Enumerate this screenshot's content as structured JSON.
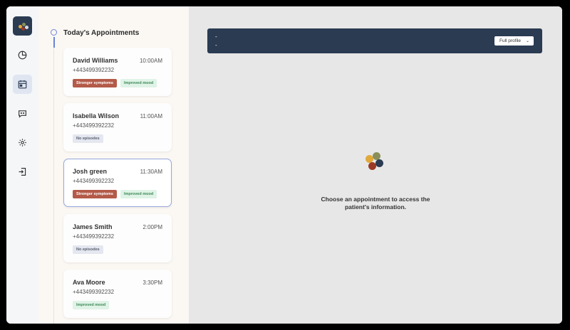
{
  "nav": {
    "items": [
      {
        "icon": "logo-icon"
      },
      {
        "icon": "pie-chart-icon"
      },
      {
        "icon": "calendar-icon",
        "active": true
      },
      {
        "icon": "chat-icon"
      },
      {
        "icon": "gear-icon"
      },
      {
        "icon": "logout-icon"
      }
    ]
  },
  "appointments": {
    "title": "Today's Appointments",
    "items": [
      {
        "name": "David Williams",
        "time": "10:00AM",
        "phone": "+443499392232",
        "tags": [
          {
            "label": "Stronger symptoms",
            "kind": "stronger"
          },
          {
            "label": "Improved mood",
            "kind": "improved"
          }
        ]
      },
      {
        "name": "Isabella Wilson",
        "time": "11:00AM",
        "phone": "+443499392232",
        "tags": [
          {
            "label": "No episodes",
            "kind": "none"
          }
        ]
      },
      {
        "name": "Josh green",
        "time": "11:30AM",
        "phone": "+443499392232",
        "selected": true,
        "tags": [
          {
            "label": "Stronger symptoms",
            "kind": "stronger"
          },
          {
            "label": "Improved mood",
            "kind": "improved"
          }
        ]
      },
      {
        "name": "James Smith",
        "time": "2:00PM",
        "phone": "+443499392232",
        "tags": [
          {
            "label": "No episodes",
            "kind": "none"
          }
        ]
      },
      {
        "name": "Ava Moore",
        "time": "3:30PM",
        "phone": "+443499392232",
        "tags": [
          {
            "label": "Improved mood",
            "kind": "improved"
          }
        ]
      }
    ]
  },
  "header": {
    "line1": "-",
    "line2": "-",
    "profile_button": "Full profile"
  },
  "empty_state": {
    "message": "Choose an appointment to access the patient's information."
  },
  "colors": {
    "navy": "#2a3b52",
    "accent": "#6b84d6",
    "stronger": "#b45a49",
    "improved_bg": "#dff3e6",
    "logo_yellow": "#e2a93a",
    "logo_olive": "#8a8f5a",
    "logo_rust": "#9a3a26",
    "logo_navy": "#2a3b52"
  }
}
